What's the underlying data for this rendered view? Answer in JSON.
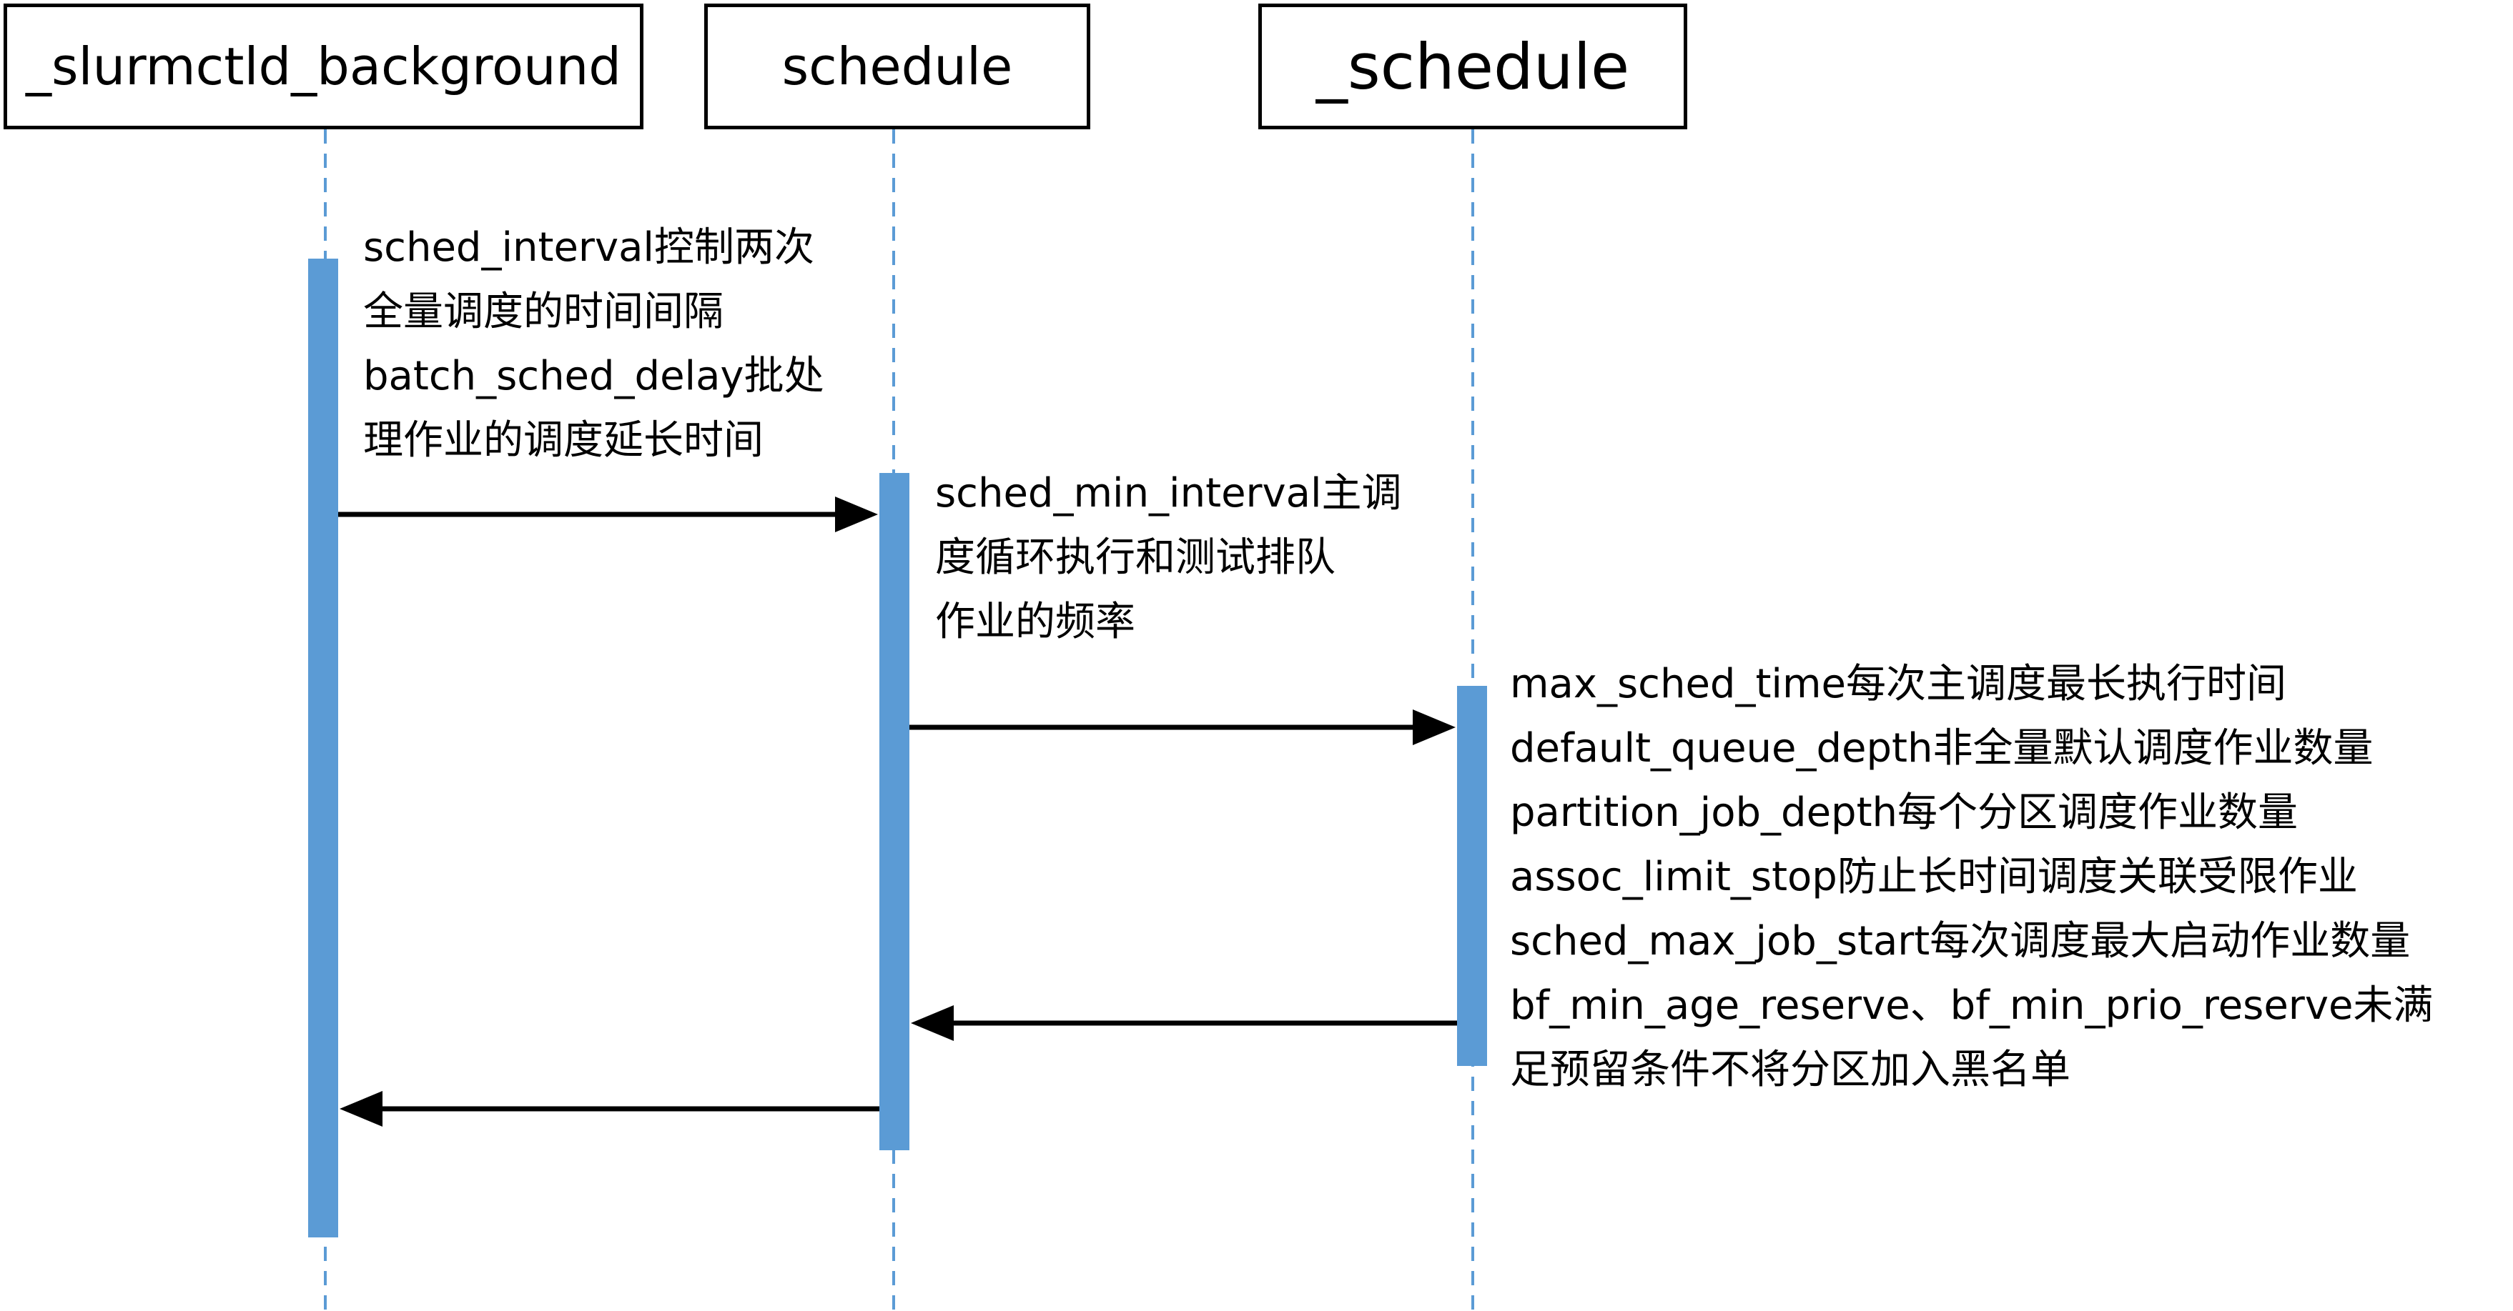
{
  "participants": [
    {
      "id": "slurmctld_background",
      "label": "_slurmctld_background"
    },
    {
      "id": "schedule",
      "label": "schedule"
    },
    {
      "id": "_schedule",
      "label": "_schedule"
    }
  ],
  "notes": [
    {
      "lines": [
        "sched_interval控制两次",
        "全量调度的时间间隔",
        "batch_sched_delay批处",
        "理作业的调度延长时间"
      ]
    },
    {
      "lines": [
        "sched_min_interval主调",
        "度循环执行和测试排队",
        "作业的频率"
      ]
    },
    {
      "lines": [
        "max_sched_time每次主调度最长执行时间",
        "default_queue_depth非全量默认调度作业数量",
        "partition_job_depth每个分区调度作业数量",
        "assoc_limit_stop防止长时间调度关联受限作业",
        "sched_max_job_start每次调度最大启动作业数量",
        "bf_min_age_reserve、bf_min_prio_reserve未满",
        "足预留条件不将分区加入黑名单"
      ]
    }
  ],
  "messages": [
    {
      "from": "slurmctld_background",
      "to": "schedule",
      "direction": "call"
    },
    {
      "from": "schedule",
      "to": "_schedule",
      "direction": "call"
    },
    {
      "from": "_schedule",
      "to": "schedule",
      "direction": "return"
    },
    {
      "from": "schedule",
      "to": "slurmctld_background",
      "direction": "return"
    }
  ],
  "colors": {
    "activation_bar": "#5b9bd5",
    "lifeline": "#5b9bd5",
    "box_border": "#000000",
    "arrow": "#000000",
    "text": "#000000"
  }
}
